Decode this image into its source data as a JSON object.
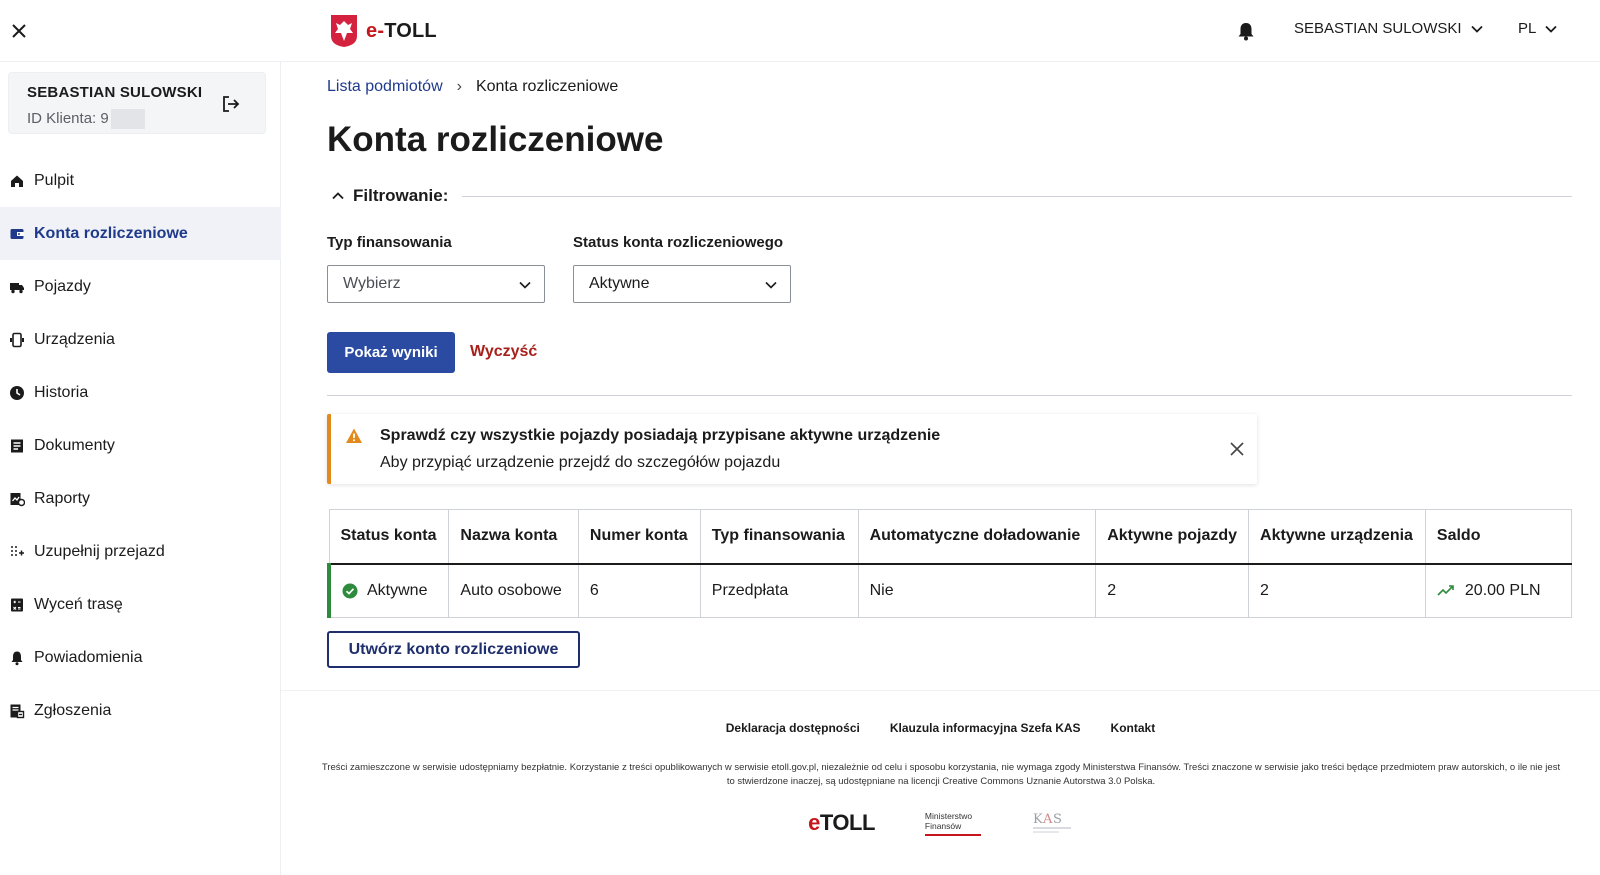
{
  "topbar": {
    "logo_text": "TOLL",
    "logo_prefix": "e-",
    "user_name": "SEBASTIAN SULOWSKI",
    "language": "PL"
  },
  "sidebar": {
    "user_name": "SEBASTIAN SULOWSKI",
    "client_id_label": "ID Klienta: 9",
    "items": [
      {
        "label": "Pulpit",
        "icon": "home-icon"
      },
      {
        "label": "Konta rozliczeniowe",
        "icon": "wallet-icon",
        "active": true
      },
      {
        "label": "Pojazdy",
        "icon": "truck-icon"
      },
      {
        "label": "Urządzenia",
        "icon": "device-icon"
      },
      {
        "label": "Historia",
        "icon": "clock-icon"
      },
      {
        "label": "Dokumenty",
        "icon": "document-icon"
      },
      {
        "label": "Raporty",
        "icon": "report-icon"
      },
      {
        "label": "Uzupełnij przejazd",
        "icon": "route-fill-icon"
      },
      {
        "label": "Wyceń trasę",
        "icon": "calculator-icon"
      },
      {
        "label": "Powiadomienia",
        "icon": "bell-icon"
      },
      {
        "label": "Zgłoszenia",
        "icon": "ticket-icon"
      }
    ]
  },
  "breadcrumb": {
    "parent": "Lista podmiotów",
    "current": "Konta rozliczeniowe"
  },
  "page": {
    "title": "Konta rozliczeniowe"
  },
  "filter": {
    "title": "Filtrowanie:",
    "financing_label": "Typ finansowania",
    "financing_value": "Wybierz",
    "status_label": "Status konta rozliczeniowego",
    "status_value": "Aktywne",
    "show_button": "Pokaż wyniki",
    "clear_button": "Wyczyść"
  },
  "alert": {
    "title": "Sprawdź czy wszystkie pojazdy posiadają przypisane aktywne urządzenie",
    "text": "Aby przypiąć urządzenie przejdź do szczegółów pojazdu"
  },
  "table": {
    "headers": [
      "Status konta",
      "Nazwa konta",
      "Numer konta",
      "Typ finansowania",
      "Automatyczne doładowanie",
      "Aktywne pojazdy",
      "Aktywne urządzenia",
      "Saldo"
    ],
    "rows": [
      [
        "Aktywne",
        "Auto osobowe",
        "6",
        "Przedpłata",
        "Nie",
        "2",
        "2",
        "20.00 PLN"
      ]
    ]
  },
  "create_button": "Utwórz konto rozliczeniowe",
  "footer": {
    "links": [
      "Deklaracja dostępności",
      "Klauzula informacyjna Szefa KAS",
      "Kontakt"
    ],
    "note": "Treści zamieszczone w serwisie udostępniamy bezpłatnie. Korzystanie z treści opublikowanych w serwisie etoll.gov.pl, niezależnie od celu i sposobu korzystania, nie wymaga zgody Ministerstwa Finansów. Treści znaczone w serwisie jako treści będące przedmiotem praw autorskich, o ile nie jest to stwierdzone inaczej, są udostępniane na licencji Creative Commons Uznanie Autorstwa 3.0 Polska.",
    "logo_etoll": "TOLL",
    "logo_mf": "Ministerstwo Finansów"
  },
  "colors": {
    "primary": "#2b4aa1",
    "nav_active": "#1f3a8a",
    "danger": "#a8201a",
    "warning": "#e38a1c",
    "success": "#2e8b3e"
  }
}
